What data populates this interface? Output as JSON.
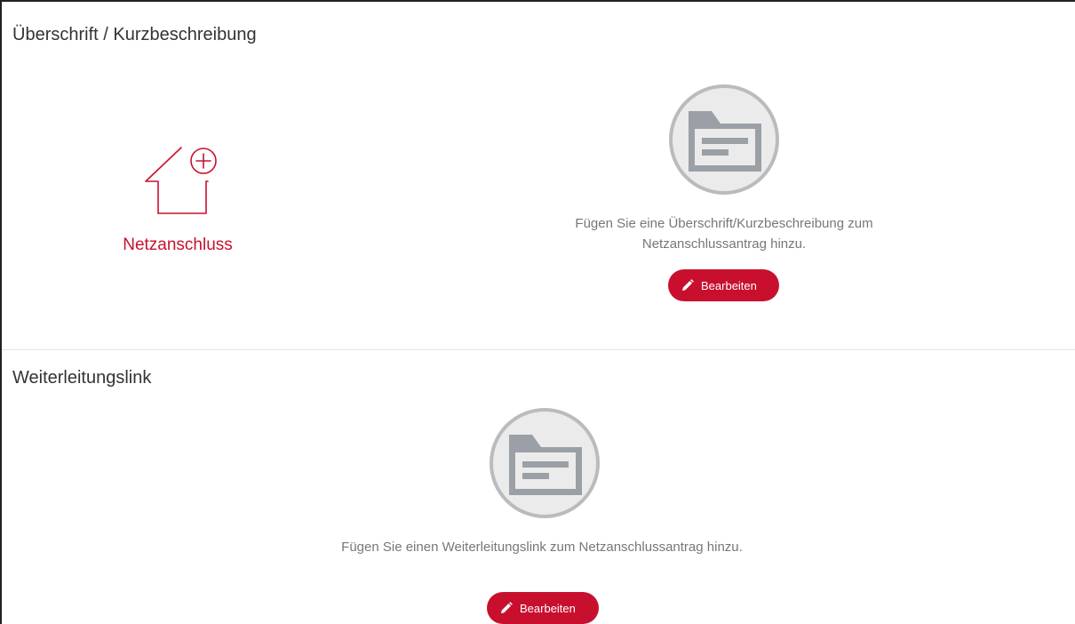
{
  "colors": {
    "brand": "#c8102e",
    "icon_gray": "#9aa0a6",
    "icon_circle_fill": "#ebebeb",
    "text_muted": "#777777"
  },
  "section_heading": {
    "title": "Überschrift / Kurzbeschreibung",
    "logo_icon": "house-plus-icon",
    "logo_text": "Netzanschluss",
    "empty_icon": "folder-document-icon",
    "description": "Fügen Sie eine Überschrift/Kurzbeschreibung zum Netzanschlussantrag hinzu.",
    "edit_icon": "pencil-icon",
    "edit_label": "Bearbeiten"
  },
  "section_forward_link": {
    "title": "Weiterleitungslink",
    "empty_icon": "folder-document-icon",
    "description": "Fügen Sie einen Weiterleitungslink zum Netzanschlussantrag hinzu.",
    "edit_icon": "pencil-icon",
    "edit_label": "Bearbeiten"
  }
}
